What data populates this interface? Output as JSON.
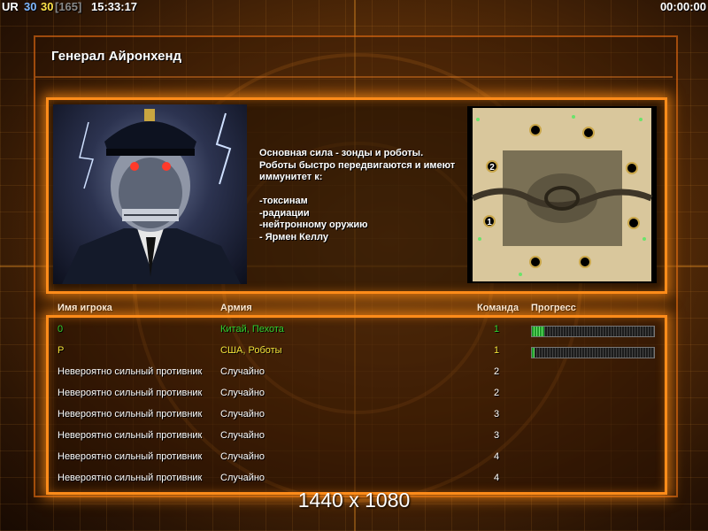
{
  "hud": {
    "ur": "UR",
    "stat1": "30",
    "stat2": "30",
    "bracket": "[165]",
    "time": "15:33:17",
    "timer": "00:00:00"
  },
  "general": {
    "title": "Генерал Айронхенд",
    "description": "Основная сила - зонды и роботы.\nРоботы быстро передвигаются и имеют\n иммунитет к:\n\n-токсинам\n-радиации\n-нейтронному оружию\n- Ярмен Келлу"
  },
  "minimap": {
    "labels": [
      "2",
      "1"
    ]
  },
  "table": {
    "headers": {
      "name": "Имя игрока",
      "army": "Армия",
      "team": "Команда",
      "progress": "Прогресс"
    },
    "rows": [
      {
        "name": "0",
        "army": "Китай, Пехота",
        "team": "1",
        "progress": 0.1,
        "color": "#2fd02f"
      },
      {
        "name": "P",
        "army": "США, Роботы",
        "team": "1",
        "progress": 0.02,
        "color": "#f2e23a"
      },
      {
        "name": "Невероятно сильный противник",
        "army": "Случайно",
        "team": "2",
        "color": "#ffffff"
      },
      {
        "name": "Невероятно сильный противник",
        "army": "Случайно",
        "team": "2",
        "color": "#ffffff"
      },
      {
        "name": "Невероятно сильный противник",
        "army": "Случайно",
        "team": "3",
        "color": "#ffffff"
      },
      {
        "name": "Невероятно сильный противник",
        "army": "Случайно",
        "team": "3",
        "color": "#ffffff"
      },
      {
        "name": "Невероятно сильный противник",
        "army": "Случайно",
        "team": "4",
        "color": "#ffffff"
      },
      {
        "name": "Невероятно сильный противник",
        "army": "Случайно",
        "team": "4",
        "color": "#ffffff"
      }
    ]
  },
  "resolution": "1440 x 1080",
  "colors": {
    "accent": "#ff8c1a",
    "player_green": "#2fd02f",
    "player_yellow": "#f2e23a"
  }
}
